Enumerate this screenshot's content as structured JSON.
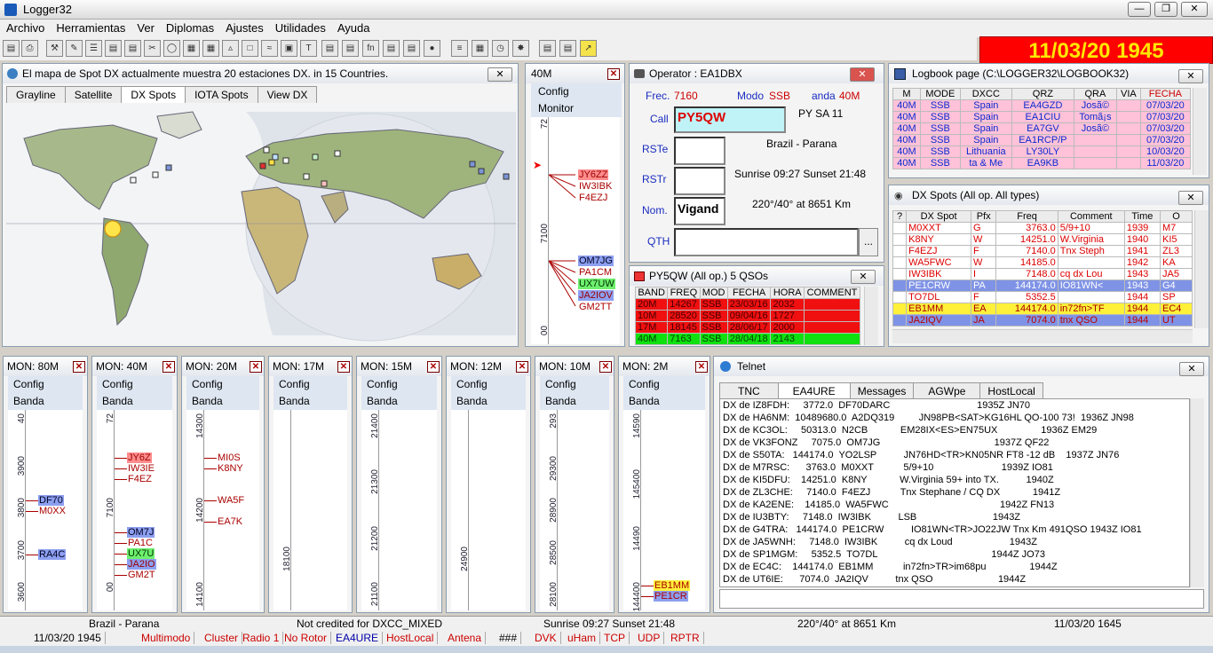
{
  "window": {
    "title": "Logger32",
    "clock": "11/03/20  1945"
  },
  "menu": [
    "Archivo",
    "Herramientas",
    "Ver",
    "Diplomas",
    "Ajustes",
    "Utilidades",
    "Ayuda"
  ],
  "map": {
    "title": "El mapa de Spot DX actualmente muestra 20 estaciones DX. in 15 Countries.",
    "tabs": [
      "Grayline",
      "Satellite",
      "DX Spots",
      "IOTA Spots",
      "View DX"
    ]
  },
  "monitor40": {
    "title": "40M",
    "config": "Config",
    "monitor": "Monitor",
    "ticks": [
      "72",
      "7100",
      "00"
    ],
    "spots": [
      "JY6ZZ",
      "IW3IBK",
      "F4EZJ",
      "OM7JG",
      "PA1CM",
      "UX7UW",
      "JA2IOV",
      "GM2TT"
    ]
  },
  "operator": {
    "title": "Operator : EA1DBX",
    "frec_label": "Frec.",
    "frec": "7160",
    "modo_label": "Modo",
    "modo": "SSB",
    "banda_label": "anda",
    "banda": "40M",
    "call_label": "Call",
    "call": "PY5QW",
    "prefix": "PY  SA  11",
    "rste_label": "RSTe",
    "rstr_label": "RSTr",
    "nom_label": "Nom.",
    "nom": "Vigand",
    "qth_label": "QTH",
    "country": "Brazil - Parana",
    "sun": "Sunrise 09:27 Sunset 21:48",
    "bearing": "220°/40° at 8651 Km",
    "dots": "..."
  },
  "logbook": {
    "title": "Logbook page (C:\\LOGGER32\\LOGBOOK32)",
    "headers": [
      "M",
      "MODE",
      "DXCC",
      "QRZ",
      "QRA",
      "VIA",
      "FECHA"
    ],
    "rows": [
      [
        "40M",
        "SSB",
        "Spain",
        "EA4GZD",
        "Josã©",
        "",
        "07/03/20"
      ],
      [
        "40M",
        "SSB",
        "Spain",
        "EA1CIU",
        "Tomã¡s",
        "",
        "07/03/20"
      ],
      [
        "40M",
        "SSB",
        "Spain",
        "EA7GV",
        "Josã©",
        "",
        "07/03/20"
      ],
      [
        "40M",
        "SSB",
        "Spain",
        "EA1RCP/P",
        "",
        "",
        "07/03/20"
      ],
      [
        "40M",
        "SSB",
        "Lithuania",
        "LY30LY",
        "",
        "",
        "10/03/20"
      ],
      [
        "40M",
        "SSB",
        "ta & Me",
        "EA9KB",
        "",
        "",
        "11/03/20"
      ]
    ]
  },
  "dxspots": {
    "title": "DX Spots (All op. All types)",
    "headers": [
      "?",
      "DX Spot",
      "Pfx",
      "Freq",
      "Comment",
      "Time",
      "O"
    ],
    "rows": [
      [
        "",
        "M0XXT",
        "G",
        "3763.0",
        "5/9+10",
        "1939",
        "M7"
      ],
      [
        "",
        "K8NY",
        "W",
        "14251.0",
        "W.Virginia",
        "1940",
        "KI5"
      ],
      [
        "",
        "F4EZJ",
        "F",
        "7140.0",
        "Tnx Steph",
        "1941",
        "ZL3"
      ],
      [
        "",
        "WA5FWC",
        "W",
        "14185.0",
        "",
        "1942",
        "KA"
      ],
      [
        "",
        "IW3IBK",
        "I",
        "7148.0",
        "cq dx Lou",
        "1943",
        "JA5"
      ],
      [
        "",
        "PE1CRW",
        "PA",
        "144174.0",
        "IO81WN<",
        "1943",
        "G4"
      ],
      [
        "",
        "TO7DL",
        "F",
        "5352.5",
        "",
        "1944",
        "SP"
      ],
      [
        "",
        "EB1MM",
        "EA",
        "144174.0",
        "in72fn>TF",
        "1944",
        "EC4"
      ],
      [
        "",
        "JA2IQV",
        "JA",
        "7074.0",
        "tnx QSO",
        "1944",
        "UT"
      ]
    ]
  },
  "qsos": {
    "title": "PY5QW (All op.)  5 QSOs",
    "headers": [
      "BAND",
      "FREQ",
      "MOD",
      "FECHA",
      "HORA",
      "COMMENT"
    ],
    "rows": [
      [
        "20M",
        "14267",
        "SSB",
        "23/03/16",
        "2032",
        ""
      ],
      [
        "10M",
        "28520",
        "SSB",
        "09/04/16",
        "1727",
        ""
      ],
      [
        "17M",
        "18145",
        "SSB",
        "28/06/17",
        "2000",
        ""
      ],
      [
        "40M",
        "7163",
        "SSB",
        "28/04/18",
        "2143",
        ""
      ]
    ]
  },
  "telnet": {
    "title": "Telnet",
    "tabs": [
      "TNC",
      "EA4URE",
      "Messages",
      "AGWpe",
      "HostLocal"
    ],
    "lines": [
      "DX de IZ8FDH:     3772.0  DF70DARC                                1935Z JN70",
      "DX de HA6NM:  10489680.0  A2DQ319         JN98PB<SAT>KG16HL QO-100 73!  1936Z JN98",
      "DX de KC3OL:     50313.0  N2CB            EM28IX<ES>EN75UX                1936Z EM29",
      "DX de VK3FONZ     7075.0  OM7JG                                          1937Z QF22",
      "DX de S50TA:   144174.0  YO2LSP          JN76HD<TR>KN05NR FT8 -12 dB    1937Z JN76",
      "DX de M7RSC:      3763.0  M0XXT           5/9+10                         1939Z IO81",
      "DX de KI5DFU:    14251.0  K8NY            W.Virginia 59+ into TX.          1940Z",
      "DX de ZL3CHE:     7140.0  F4EZJ           Tnx Stephane / CQ DX            1941Z",
      "DX de KA2ENE:    14185.0  WA5FWC                                         1942Z FN13",
      "DX de IU3BTY:     7148.0  IW3IBK          LSB                            1943Z",
      "DX de G4TRA:   144174.0  PE1CRW          IO81WN<TR>JO22JW Tnx Km 491QSO 1943Z IO81",
      "DX de JA5WNH:     7148.0  IW3IBK          cq dx Loud                     1943Z",
      "DX de SP1MGM:     5352.5  TO7DL                                          1944Z JO73",
      "DX de EC4C:    144174.0  EB1MM           in72fn>TR>im68pu                1944Z",
      "DX de UT6IE:      7074.0  JA2IQV          tnx QSO                        1944Z"
    ]
  },
  "bands": [
    {
      "title": "MON: 80M",
      "config": "Config",
      "banda": "Banda",
      "ticks": [
        "40",
        "3900",
        "3800",
        "3700",
        "3600"
      ],
      "spots": [
        "DF70",
        "M0XX",
        "RA4C"
      ]
    },
    {
      "title": "MON: 40M",
      "config": "Config",
      "banda": "Banda",
      "ticks": [
        "72",
        "7100",
        "00"
      ],
      "spots": [
        "JY6Z",
        "IW3IE",
        "F4EZ",
        "OM7J",
        "PA1C",
        "UX7U",
        "JA2IO",
        "GM2T"
      ]
    },
    {
      "title": "MON: 20M",
      "config": "Config",
      "banda": "Banda",
      "ticks": [
        "14300",
        "14200",
        "14100"
      ],
      "spots": [
        "MI0S",
        "K8NY",
        "WA5F",
        "EA7K"
      ]
    },
    {
      "title": "MON: 17M",
      "config": "Config",
      "banda": "Banda",
      "ticks": [
        "18100"
      ],
      "spots": []
    },
    {
      "title": "MON: 15M",
      "config": "Config",
      "banda": "Banda",
      "ticks": [
        "21400",
        "21300",
        "21200",
        "21100"
      ],
      "spots": []
    },
    {
      "title": "MON: 12M",
      "config": "Config",
      "banda": "Banda",
      "ticks": [
        "24900"
      ],
      "spots": []
    },
    {
      "title": "MON: 10M",
      "config": "Config",
      "banda": "Banda",
      "ticks": [
        "293",
        "29300",
        "28900",
        "28500",
        "28100"
      ],
      "spots": []
    },
    {
      "title": "MON: 2M",
      "config": "Config",
      "banda": "Banda",
      "ticks": [
        "14590",
        "145400",
        "14490",
        "144400"
      ],
      "spots": [
        "EB1MM",
        "PE1CR"
      ]
    }
  ],
  "status": {
    "a": "Brazil - Parana",
    "b": "Not credited for DXCC_MIXED",
    "c": "Sunrise 09:27 Sunset 21:48",
    "d": "220°/40° at 8651 Km",
    "e": "11/03/20  1645"
  },
  "status2": [
    "11/03/20  1945",
    "Multimodo",
    "Cluster",
    "Radio 1",
    "No Rotor",
    "EA4URE",
    "HostLocal",
    "Antena",
    "###",
    "DVK",
    "uHam",
    "TCP",
    "UDP",
    "RPTR"
  ]
}
